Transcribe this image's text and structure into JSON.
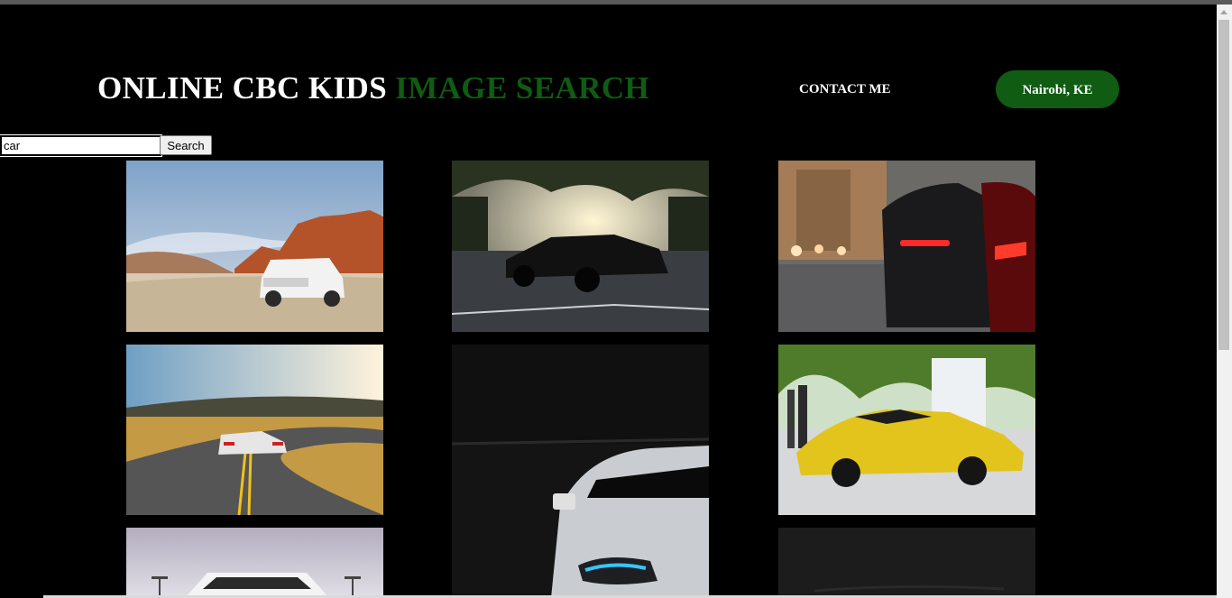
{
  "header": {
    "title_white": "ONLINE CBC KIDS",
    "title_green": "IMAGE SEARCH",
    "contact_label": "CONTACT ME",
    "location_label": "Nairobi, KE"
  },
  "search": {
    "value": "car",
    "button_label": "Search"
  },
  "results": [
    {
      "subject": "white SUV on desert road"
    },
    {
      "subject": "black sports car at sunset parking lot"
    },
    {
      "subject": "red tail lights of car on city street"
    },
    {
      "subject": "white sports car on winding road"
    },
    {
      "subject": "white car headlight in dark garage"
    },
    {
      "subject": "yellow sports car on street"
    },
    {
      "subject": "white car front under cloudy sky"
    },
    {
      "subject": "dark car image"
    }
  ],
  "colors": {
    "background": "#000000",
    "accent_green": "#0f5c12",
    "text": "#ffffff"
  }
}
